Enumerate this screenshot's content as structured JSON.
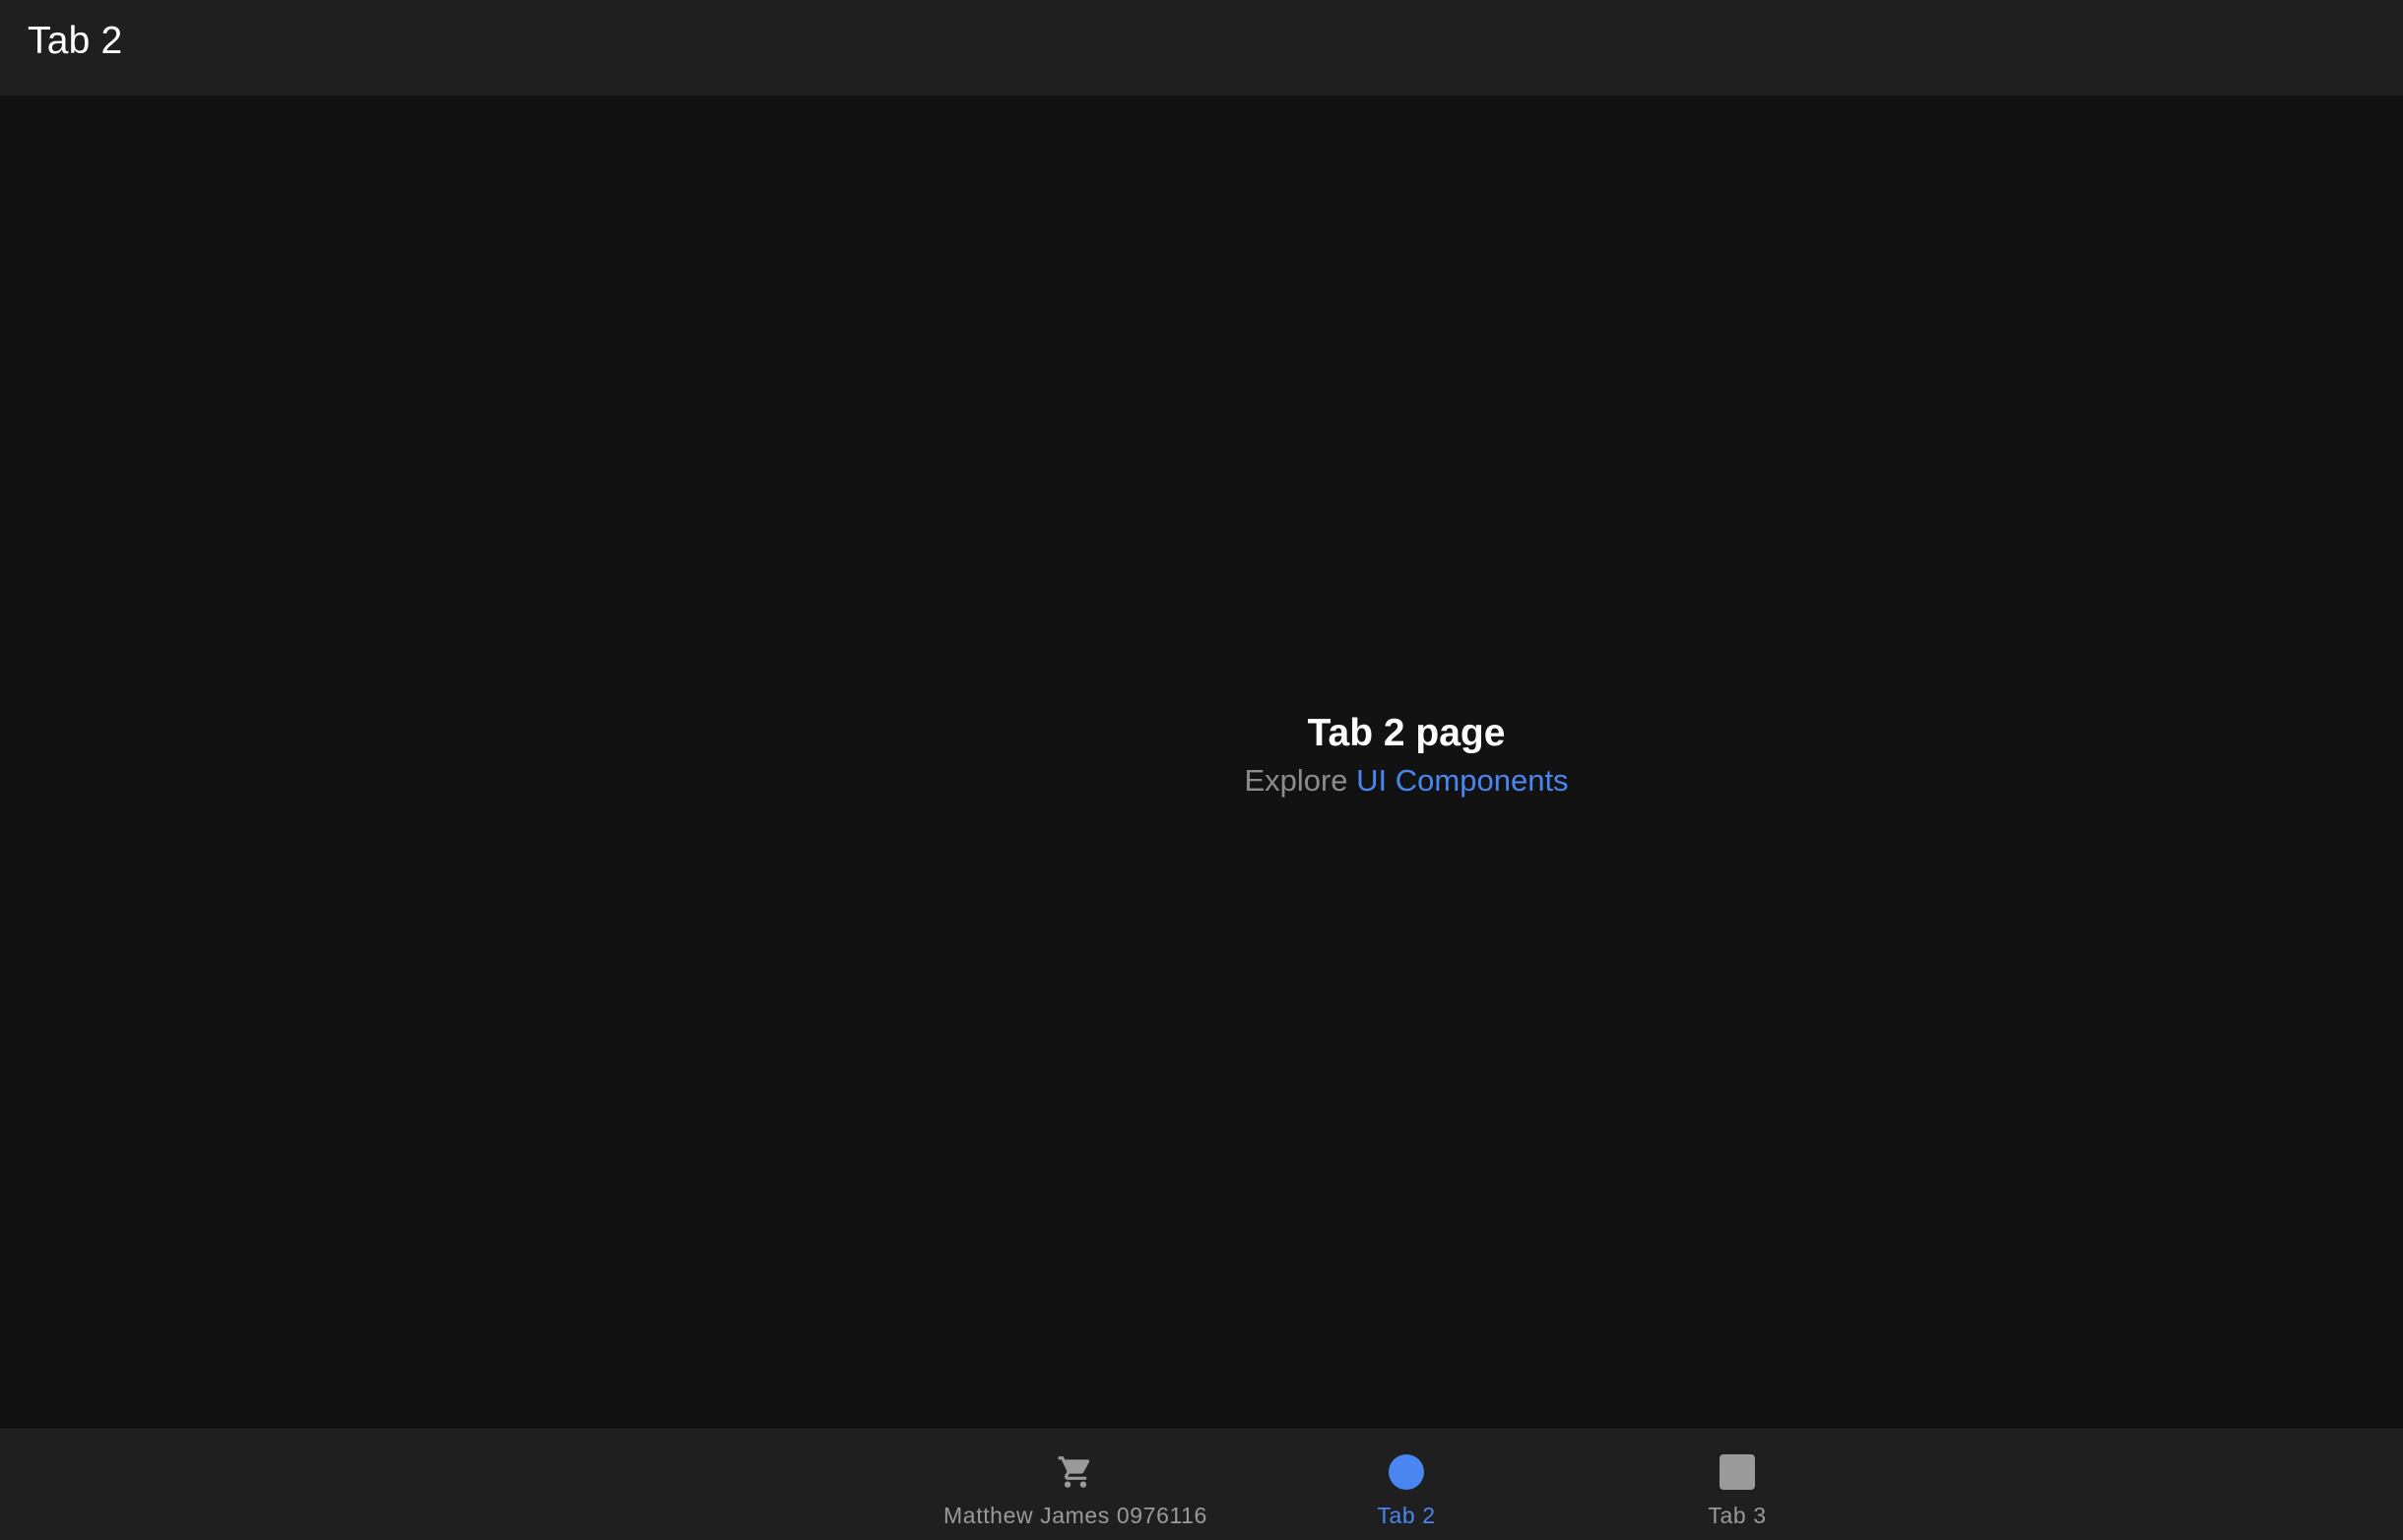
{
  "header": {
    "title": "Tab 2"
  },
  "main": {
    "heading": "Tab 2 page",
    "explore_prefix": "Explore",
    "explore_link": "UI Components"
  },
  "tabbar": {
    "tabs": [
      {
        "label": "Matthew James 0976116",
        "icon": "cart-icon",
        "active": false
      },
      {
        "label": "Tab 2",
        "icon": "circle-icon",
        "active": true
      },
      {
        "label": "Tab 3",
        "icon": "square-icon",
        "active": false
      }
    ]
  },
  "colors": {
    "background": "#121212",
    "toolbar": "#1f1f1f",
    "accent": "#4a86f0",
    "inactive": "#9a9a9a"
  }
}
